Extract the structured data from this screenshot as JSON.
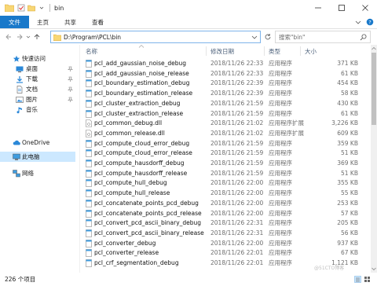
{
  "window": {
    "title": "bin"
  },
  "ribbon": {
    "tabs": [
      "文件",
      "主页",
      "共享",
      "查看"
    ]
  },
  "address": {
    "path": "D:\\Program\\PCL\\bin",
    "search_placeholder": "搜索\"bin\""
  },
  "nav": {
    "quick_access": "快速访问",
    "items": [
      "桌面",
      "下载",
      "文档",
      "图片",
      "音乐"
    ],
    "onedrive": "OneDrive",
    "this_pc": "此电脑",
    "network": "网络"
  },
  "columns": {
    "name": "名称",
    "date": "修改日期",
    "type": "类型",
    "size": "大小"
  },
  "files": [
    {
      "name": "pcl_add_gaussian_noise_debug",
      "date": "2018/11/26 22:33",
      "type": "应用程序",
      "size": "371 KB",
      "kind": "exe"
    },
    {
      "name": "pcl_add_gaussian_noise_release",
      "date": "2018/11/26 22:33",
      "type": "应用程序",
      "size": "61 KB",
      "kind": "exe"
    },
    {
      "name": "pcl_boundary_estimation_debug",
      "date": "2018/11/26 22:39",
      "type": "应用程序",
      "size": "454 KB",
      "kind": "exe"
    },
    {
      "name": "pcl_boundary_estimation_release",
      "date": "2018/11/26 22:39",
      "type": "应用程序",
      "size": "58 KB",
      "kind": "exe"
    },
    {
      "name": "pcl_cluster_extraction_debug",
      "date": "2018/11/26 21:59",
      "type": "应用程序",
      "size": "430 KB",
      "kind": "exe"
    },
    {
      "name": "pcl_cluster_extraction_release",
      "date": "2018/11/26 21:59",
      "type": "应用程序",
      "size": "61 KB",
      "kind": "exe"
    },
    {
      "name": "pcl_common_debug.dll",
      "date": "2018/11/26 21:02",
      "type": "应用程序扩展",
      "size": "3,226 KB",
      "kind": "dll"
    },
    {
      "name": "pcl_common_release.dll",
      "date": "2018/11/26 21:02",
      "type": "应用程序扩展",
      "size": "609 KB",
      "kind": "dll"
    },
    {
      "name": "pcl_compute_cloud_error_debug",
      "date": "2018/11/26 21:59",
      "type": "应用程序",
      "size": "359 KB",
      "kind": "exe"
    },
    {
      "name": "pcl_compute_cloud_error_release",
      "date": "2018/11/26 21:59",
      "type": "应用程序",
      "size": "51 KB",
      "kind": "exe"
    },
    {
      "name": "pcl_compute_hausdorff_debug",
      "date": "2018/11/26 21:59",
      "type": "应用程序",
      "size": "369 KB",
      "kind": "exe"
    },
    {
      "name": "pcl_compute_hausdorff_release",
      "date": "2018/11/26 21:59",
      "type": "应用程序",
      "size": "51 KB",
      "kind": "exe"
    },
    {
      "name": "pcl_compute_hull_debug",
      "date": "2018/11/26 22:00",
      "type": "应用程序",
      "size": "355 KB",
      "kind": "exe"
    },
    {
      "name": "pcl_compute_hull_release",
      "date": "2018/11/26 22:00",
      "type": "应用程序",
      "size": "55 KB",
      "kind": "exe"
    },
    {
      "name": "pcl_concatenate_points_pcd_debug",
      "date": "2018/11/26 22:00",
      "type": "应用程序",
      "size": "253 KB",
      "kind": "exe"
    },
    {
      "name": "pcl_concatenate_points_pcd_release",
      "date": "2018/11/26 22:00",
      "type": "应用程序",
      "size": "57 KB",
      "kind": "exe"
    },
    {
      "name": "pcl_convert_pcd_ascii_binary_debug",
      "date": "2018/11/26 22:31",
      "type": "应用程序",
      "size": "205 KB",
      "kind": "exe"
    },
    {
      "name": "pcl_convert_pcd_ascii_binary_release",
      "date": "2018/11/26 22:31",
      "type": "应用程序",
      "size": "56 KB",
      "kind": "exe"
    },
    {
      "name": "pcl_converter_debug",
      "date": "2018/11/26 22:00",
      "type": "应用程序",
      "size": "937 KB",
      "kind": "exe"
    },
    {
      "name": "pcl_converter_release",
      "date": "2018/11/26 22:01",
      "type": "应用程序",
      "size": "67 KB",
      "kind": "exe"
    },
    {
      "name": "pcl_crf_segmentation_debug",
      "date": "2018/11/26 22:01",
      "type": "应用程序",
      "size": "1,121 KB",
      "kind": "exe"
    }
  ],
  "status": {
    "count": "226 个项目"
  },
  "watermark": "@51CTO博客",
  "colors": {
    "accent": "#1979ca",
    "selected": "#cce8ff",
    "folder": "#f8d775"
  }
}
